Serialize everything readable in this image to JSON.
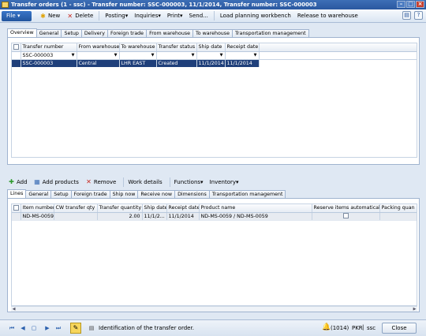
{
  "window": {
    "title": "Transfer orders (1 - ssc) - Transfer number: SSC-000003, 11/1/2014, Transfer number: SSC-000003"
  },
  "toolbar": {
    "file": "File",
    "items": [
      "New",
      "Delete",
      "Posting",
      "Inquiries",
      "Print",
      "Send...",
      "Load planning workbench",
      "Release to warehouse"
    ]
  },
  "header_tabs": [
    "Overview",
    "General",
    "Setup",
    "Delivery",
    "Foreign trade",
    "From warehouse",
    "To warehouse",
    "Transportation management"
  ],
  "header_grid": {
    "columns": [
      "Transfer number",
      "From warehouse",
      "To warehouse",
      "Transfer status",
      "Ship date",
      "Receipt date"
    ],
    "filter_value": "SSC-000003",
    "rows": [
      [
        "SSC-000003",
        "Central",
        "LHR EAST",
        "Created",
        "11/1/2014",
        "11/1/2014"
      ]
    ]
  },
  "lines_toolbar": [
    "Add",
    "Add products",
    "Remove",
    "Work details",
    "Functions",
    "Inventory"
  ],
  "line_tabs": [
    "Lines",
    "General",
    "Setup",
    "Foreign trade",
    "Ship now",
    "Receive now",
    "Dimensions",
    "Transportation management"
  ],
  "lines_grid": {
    "columns": [
      "Item number",
      "CW transfer qty",
      "Transfer quantity",
      "Ship date",
      "Receipt date",
      "Product name",
      "Reserve items automatically",
      "Packing quan"
    ],
    "rows": [
      [
        "ND-MS-0059",
        "",
        "2.00",
        "11/1/2...",
        "11/1/2014",
        "ND-MS-0059 / ND-MS-0059",
        "",
        "0"
      ]
    ]
  },
  "status": {
    "message": "Identification of the transfer order.",
    "alerts": "(1014)",
    "currency": "PKR",
    "company": "ssc",
    "close": "Close"
  }
}
